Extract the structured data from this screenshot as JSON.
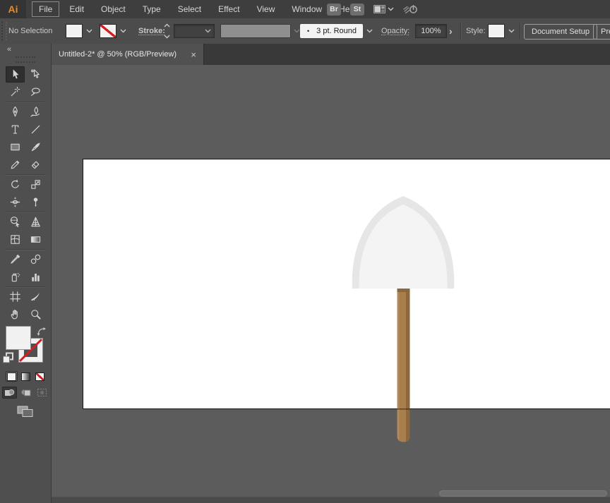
{
  "menubar": {
    "logo_text": "Ai",
    "items": [
      {
        "label": "File",
        "boxed": true
      },
      {
        "label": "Edit"
      },
      {
        "label": "Object"
      },
      {
        "label": "Type"
      },
      {
        "label": "Select"
      },
      {
        "label": "Effect"
      },
      {
        "label": "View"
      },
      {
        "label": "Window"
      },
      {
        "label": "Help"
      }
    ],
    "bridge_label": "Br",
    "stock_label": "St"
  },
  "controlbar": {
    "selection_status": "No Selection",
    "fill_swatch_color": "#ffffff",
    "stroke_swatch": "none",
    "stroke_label": "Stroke:",
    "brush_dot": "•",
    "brush_value": "3 pt. Round",
    "opacity_label": "Opacity:",
    "opacity_value": "100%",
    "opacity_more_glyph": "›",
    "style_label": "Style:",
    "document_setup_label": "Document Setup",
    "preferences_label": "Pref"
  },
  "tabbar": {
    "tab_title": "Untitled-2* @ 50% (RGB/Preview)",
    "close_glyph": "×"
  },
  "toolpanel": {
    "collapse_glyph": "«",
    "fill_color": "#f1f1f1",
    "stroke_color": "none",
    "tools": [
      {
        "name": "selection",
        "active": true
      },
      {
        "name": "direct-selection"
      },
      {
        "name": "magic-wand"
      },
      {
        "name": "lasso",
        "sep_after": true
      },
      {
        "name": "pen"
      },
      {
        "name": "curvature"
      },
      {
        "name": "type"
      },
      {
        "name": "line-segment"
      },
      {
        "name": "rectangle"
      },
      {
        "name": "paintbrush"
      },
      {
        "name": "pencil"
      },
      {
        "name": "eraser",
        "sep_after": true
      },
      {
        "name": "rotate"
      },
      {
        "name": "scale"
      },
      {
        "name": "width"
      },
      {
        "name": "puppet-warp",
        "sep_after": true
      },
      {
        "name": "shape-builder"
      },
      {
        "name": "perspective-grid"
      },
      {
        "name": "mesh"
      },
      {
        "name": "gradient",
        "sep_after": true
      },
      {
        "name": "eyedropper"
      },
      {
        "name": "blend"
      },
      {
        "name": "symbol-sprayer"
      },
      {
        "name": "column-graph",
        "sep_after": true
      },
      {
        "name": "artboard"
      },
      {
        "name": "slice"
      },
      {
        "name": "hand"
      },
      {
        "name": "zoom"
      }
    ]
  },
  "canvas": {
    "artboard_color": "#ffffff",
    "workspace_color": "#5c5c5c",
    "shovel": {
      "head_band": "#e6e6e6",
      "head_fill": "#f4f4f4",
      "handle_main": "#a87e4c",
      "handle_shade": "#8d683c",
      "handle_highlight": "#b28a5c",
      "handle_top_band": "#8a673f"
    }
  }
}
